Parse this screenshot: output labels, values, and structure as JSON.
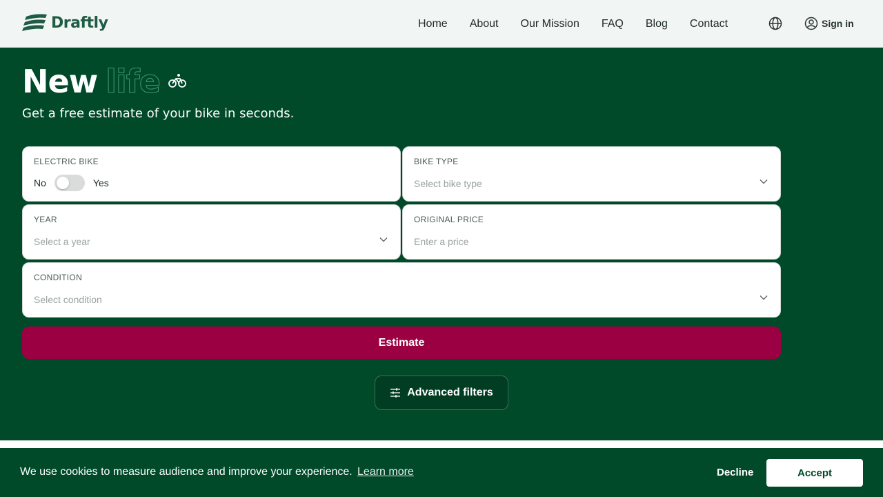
{
  "header": {
    "brand": "Draftly",
    "nav": [
      "Home",
      "About",
      "Our Mission",
      "FAQ",
      "Blog",
      "Contact"
    ],
    "sign_in": "Sign in"
  },
  "hero": {
    "title_main": "New",
    "title_outline": "life",
    "subtitle": "Get a free estimate of your bike in seconds."
  },
  "form": {
    "electric": {
      "label": "ELECTRIC BIKE",
      "no": "No",
      "yes": "Yes"
    },
    "bike_type": {
      "label": "BIKE TYPE",
      "placeholder": "Select bike type"
    },
    "year": {
      "label": "YEAR",
      "placeholder": "Select a year"
    },
    "price": {
      "label": "ORIGINAL PRICE",
      "placeholder": "Enter a price"
    },
    "condition": {
      "label": "CONDITION",
      "placeholder": "Select condition"
    },
    "estimate_button": "Estimate",
    "advanced_filters": "Advanced filters"
  },
  "cookie": {
    "message": "We use cookies to measure audience and improve your experience.",
    "learn_more": "Learn more",
    "decline": "Decline",
    "accept": "Accept"
  },
  "colors": {
    "primary_green": "#004a2a",
    "accent_red": "#9b0042",
    "header_bg": "#f1f5f3"
  }
}
